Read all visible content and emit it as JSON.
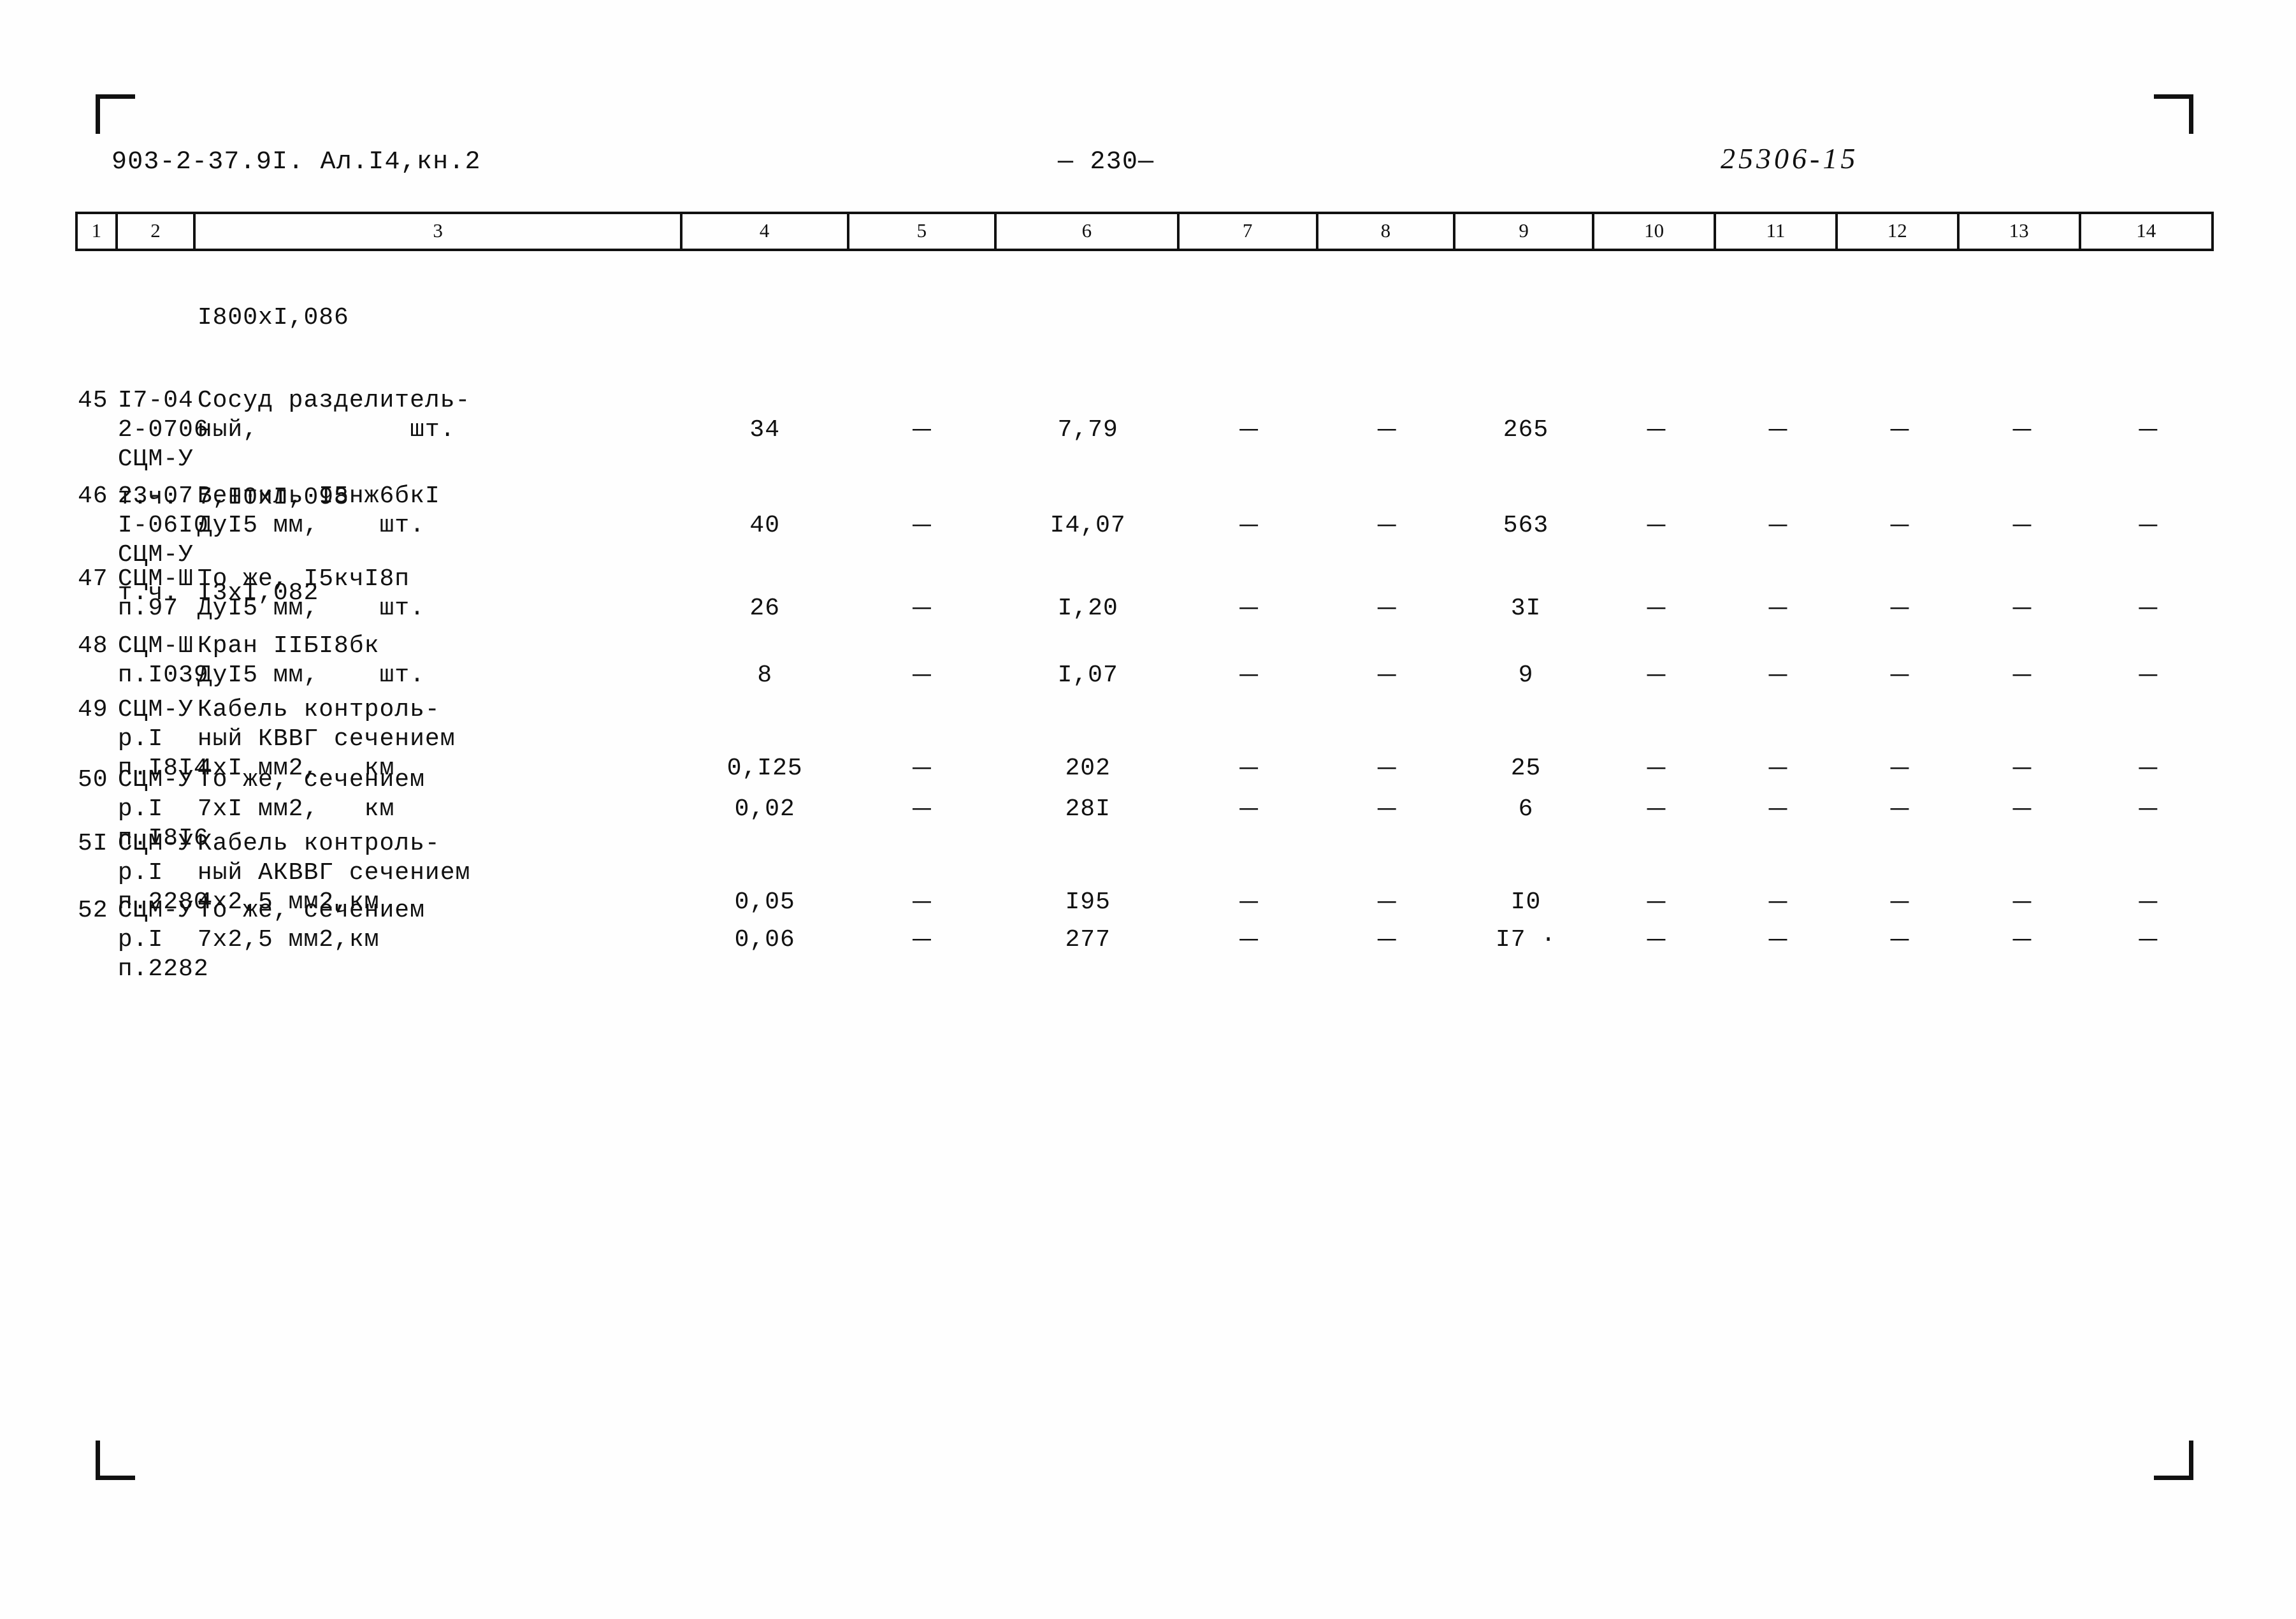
{
  "header": {
    "doc_id": "903-2-37.9I. Ал.I4,кн.2",
    "page_number": "— 230—",
    "archive_code": "25306-15"
  },
  "table": {
    "column_numbers": [
      "1",
      "2",
      "3",
      "4",
      "5",
      "6",
      "7",
      "8",
      "9",
      "10",
      "11",
      "12",
      "13",
      "14"
    ],
    "preceding_line": "I800xI,086",
    "dash_glyph": "—",
    "rows": [
      {
        "num": "45",
        "code_lines": [
          "I7-04",
          "2-0706",
          "СЦМ-У",
          "т.ч."
        ],
        "desc_lines": [
          "Сосуд разделитель-",
          "ный,          шт.",
          "",
          "7,I0xI,098"
        ],
        "col4": "34",
        "col5": "—",
        "col6": "7,79",
        "col7": "—",
        "col8": "—",
        "col9": "265",
        "col10": "—",
        "col11": "—",
        "col12": "—",
        "col13": "—",
        "col14": "—"
      },
      {
        "num": "46",
        "code_lines": [
          "23-07",
          "I-06I0",
          "СЦМ-У",
          "т.ч."
        ],
        "desc_lines": [
          "Вентиль I5нж6бкI",
          "ДуI5 мм,    шт.",
          "",
          "I3xI,082"
        ],
        "col4": "40",
        "col5": "—",
        "col6": "I4,07",
        "col7": "—",
        "col8": "—",
        "col9": "563",
        "col10": "—",
        "col11": "—",
        "col12": "—",
        "col13": "—",
        "col14": "—"
      },
      {
        "num": "47",
        "code_lines": [
          "СЦМ-Ш",
          "п.97"
        ],
        "desc_lines": [
          "То же, I5кчI8п",
          "ДуI5 мм,    шт."
        ],
        "col4": "26",
        "col5": "—",
        "col6": "I,20",
        "col7": "—",
        "col8": "—",
        "col9": "3I",
        "col10": "—",
        "col11": "—",
        "col12": "—",
        "col13": "—",
        "col14": "—"
      },
      {
        "num": "48",
        "code_lines": [
          "СЦМ-Ш",
          "п.I039"
        ],
        "desc_lines": [
          "Кран IIБI8бк",
          "ДуI5 мм,    шт."
        ],
        "col4": "8",
        "col5": "—",
        "col6": "I,07",
        "col7": "—",
        "col8": "—",
        "col9": "9",
        "col10": "—",
        "col11": "—",
        "col12": "—",
        "col13": "—",
        "col14": "—"
      },
      {
        "num": "49",
        "code_lines": [
          "СЦМ-У",
          "р.I",
          "п.I8I4"
        ],
        "desc_lines": [
          "Кабель контроль-",
          "ный КВВГ сечением",
          "4xI мм2,   км"
        ],
        "col4": "0,I25",
        "col5": "—",
        "col6": "202",
        "col7": "—",
        "col8": "—",
        "col9": "25",
        "col10": "—",
        "col11": "—",
        "col12": "—",
        "col13": "—",
        "col14": "—"
      },
      {
        "num": "50",
        "code_lines": [
          "СЦМ-У",
          "р.I",
          "п.I8I6"
        ],
        "desc_lines": [
          "То же, сечением",
          "7xI мм2,   км",
          ""
        ],
        "col4": "0,02",
        "col5": "—",
        "col6": "28I",
        "col7": "—",
        "col8": "—",
        "col9": "6",
        "col10": "—",
        "col11": "—",
        "col12": "—",
        "col13": "—",
        "col14": "—"
      },
      {
        "num": "5I",
        "code_lines": [
          "СЦМ-У",
          "р.I",
          "п.2280"
        ],
        "desc_lines": [
          "Кабель контроль-",
          "ный АКВВГ сечением",
          "4x2,5 мм2,км"
        ],
        "col4": "0,05",
        "col5": "—",
        "col6": "I95",
        "col7": "—",
        "col8": "—",
        "col9": "I0",
        "col10": "—",
        "col11": "—",
        "col12": "—",
        "col13": "—",
        "col14": "—"
      },
      {
        "num": "52",
        "code_lines": [
          "СЦМ-У",
          "р.I",
          "п.2282"
        ],
        "desc_lines": [
          "То же, сечением",
          "7x2,5 мм2,км",
          ""
        ],
        "col4": "0,06",
        "col5": "—",
        "col6": "277",
        "col7": "—",
        "col8": "—",
        "col9": "I7 ·",
        "col10": "—",
        "col11": "—",
        "col12": "—",
        "col13": "—",
        "col14": "—"
      }
    ]
  }
}
